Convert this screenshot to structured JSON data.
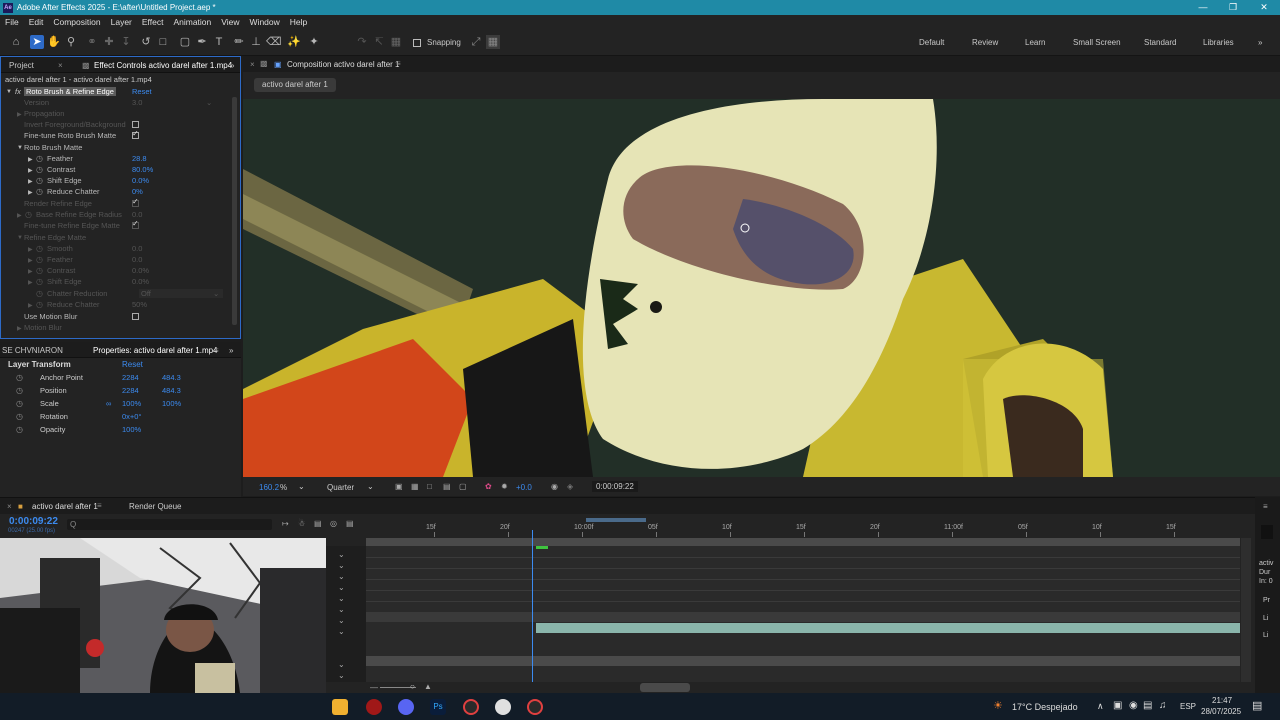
{
  "titlebar": {
    "title": "Adobe After Effects 2025 - E:\\after\\Untitled Project.aep *",
    "logo": "Ae"
  },
  "menu": [
    "File",
    "Edit",
    "Composition",
    "Layer",
    "Effect",
    "Animation",
    "View",
    "Window",
    "Help"
  ],
  "toolbar": {
    "snapping": "Snapping"
  },
  "workspaces": [
    "Default",
    "Review",
    "Learn",
    "Small Screen",
    "Standard",
    "Libraries"
  ],
  "left_panel": {
    "tab_project": "Project",
    "tab_effect": "Effect Controls activo darel after 1.mp4",
    "layer_path": "activo darel after 1 - activo darel after 1.mp4",
    "effect_name": "Roto Brush & Refine Edge",
    "reset": "Reset",
    "rows": [
      {
        "label": "Version",
        "value": "3.0",
        "disabled": true
      },
      {
        "label": "Propagation",
        "disabled": true
      },
      {
        "label": "Invert Foreground/Background",
        "disabled": true
      },
      {
        "label": "Fine-tune Roto Brush Matte"
      },
      {
        "label": "Roto Brush Matte"
      },
      {
        "label": "Feather",
        "value": "28.8"
      },
      {
        "label": "Contrast",
        "value": "80.0%"
      },
      {
        "label": "Shift Edge",
        "value": "0.0%"
      },
      {
        "label": "Reduce Chatter",
        "value": "0%"
      },
      {
        "label": "Render Refine Edge",
        "disabled": true
      },
      {
        "label": "Base Refine Edge Radius",
        "value": "0.0",
        "disabled": true
      },
      {
        "label": "Fine-tune Refine Edge Matte",
        "disabled": true
      },
      {
        "label": "Refine Edge Matte",
        "disabled": true
      },
      {
        "label": "Smooth",
        "value": "0.0",
        "disabled": true
      },
      {
        "label": "Feather",
        "value": "0.0",
        "disabled": true
      },
      {
        "label": "Contrast",
        "value": "0.0%",
        "disabled": true
      },
      {
        "label": "Shift Edge",
        "value": "0.0%",
        "disabled": true
      },
      {
        "label": "Chatter Reduction",
        "value": "Off",
        "disabled": true
      },
      {
        "label": "Reduce Chatter",
        "value": "50%",
        "disabled": true
      },
      {
        "label": "Use Motion Blur"
      },
      {
        "label": "Motion Blur",
        "disabled": true
      }
    ]
  },
  "properties": {
    "tab_left": "SE CHVNIARON",
    "tab": "Properties: activo darel after 1.mp4",
    "section": "Layer Transform",
    "reset": "Reset",
    "rows": [
      {
        "label": "Anchor Point",
        "v1": "2284",
        "v2": "484.3"
      },
      {
        "label": "Position",
        "v1": "2284",
        "v2": "484.3"
      },
      {
        "label": "Scale",
        "v1": "100%",
        "v2": "100%"
      },
      {
        "label": "Rotation",
        "v1": "0x+0°",
        "v2": ""
      },
      {
        "label": "Opacity",
        "v1": "100%",
        "v2": ""
      }
    ]
  },
  "viewer": {
    "tab": "Composition activo darel after 1",
    "subtab": "activo darel after 1",
    "zoom": "160.2",
    "zoom_unit": "%",
    "resolution": "Quarter",
    "exposure": "+0.0",
    "timecode": "0:00:09:22"
  },
  "timeline": {
    "tab": "activo darel after 1",
    "render_queue": "Render Queue",
    "timecode": "0:00:09:22",
    "frames": "00247 (25.00 fps)",
    "search_placeholder": "Q",
    "ruler": [
      "15f",
      "20f",
      "10:00f",
      "05f",
      "10f",
      "15f",
      "20f",
      "11:00f",
      "05f",
      "10f",
      "15f"
    ],
    "playhead_fraction": 0.19,
    "right_labels": [
      "activ",
      "Dur",
      "In: 0",
      "Pr",
      "Li",
      "Li"
    ]
  },
  "taskbar": {
    "weather": "17°C  Despejado",
    "lang": "ESP",
    "time": "21:47",
    "date": "28/07/2025"
  }
}
